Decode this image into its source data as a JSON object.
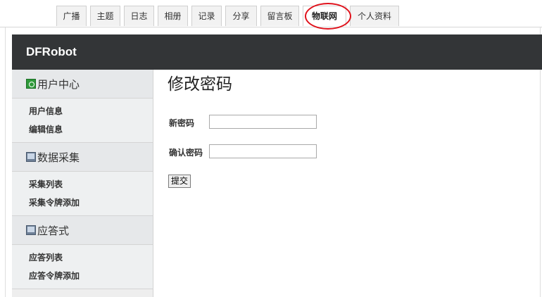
{
  "tabs": [
    {
      "label": "广播",
      "active": false
    },
    {
      "label": "主题",
      "active": false
    },
    {
      "label": "日志",
      "active": false
    },
    {
      "label": "相册",
      "active": false
    },
    {
      "label": "记录",
      "active": false
    },
    {
      "label": "分享",
      "active": false
    },
    {
      "label": "留言板",
      "active": false
    },
    {
      "label": "物联网",
      "active": true
    },
    {
      "label": "个人资料",
      "active": false
    }
  ],
  "header": {
    "brand": "DFRobot"
  },
  "sidebar": {
    "sections": [
      {
        "title": "用户中心",
        "icon": "user-center-icon",
        "links": [
          "用户信息",
          "编辑信息"
        ]
      },
      {
        "title": "数据采集",
        "icon": "monitor-icon",
        "links": [
          "采集列表",
          "采集令牌添加"
        ]
      },
      {
        "title": "应答式",
        "icon": "monitor-icon",
        "links": [
          "应答列表",
          "应答令牌添加"
        ]
      }
    ]
  },
  "main": {
    "title": "修改密码",
    "new_password_label": "新密码",
    "new_password_value": "",
    "confirm_password_label": "确认密码",
    "confirm_password_value": "",
    "submit_label": "提交"
  },
  "colors": {
    "header_bg": "#333537",
    "highlight_marker": "#e0111b",
    "sidebar_bg": "#eeeeee"
  }
}
